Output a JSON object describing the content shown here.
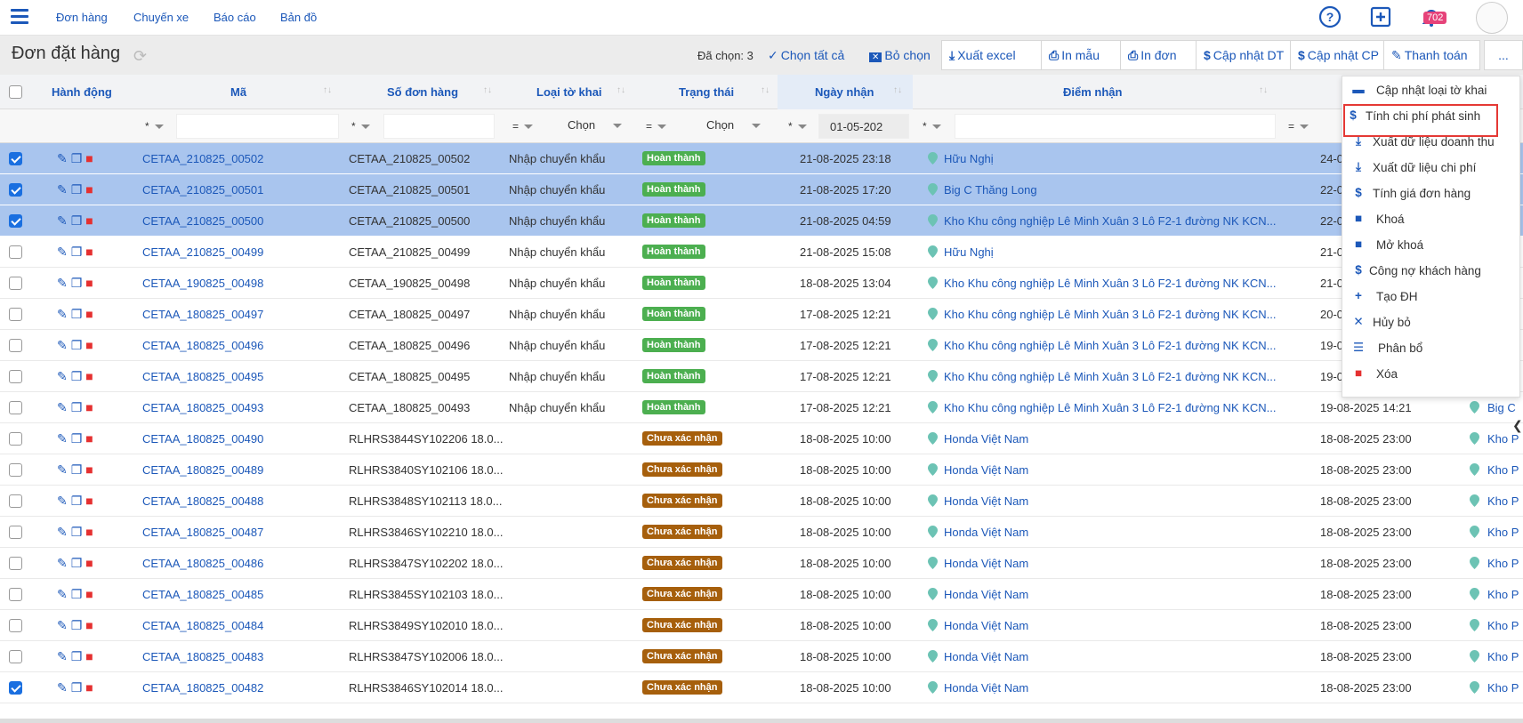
{
  "nav": {
    "links": [
      "Đơn hàng",
      "Chuyến xe",
      "Báo cáo",
      "Bản đồ"
    ],
    "notification_count": "702",
    "accent": "#1c58b9"
  },
  "toolbar": {
    "title": "Đơn đặt hàng",
    "selected": "Đã chọn: 3",
    "select_all": "Chọn tất cả",
    "deselect": "Bỏ chọn",
    "buttons": [
      "Xuất excel",
      "In mẫu",
      "In đơn",
      "Cập nhật DT",
      "Cập nhật CP",
      "Thanh toán",
      "..."
    ]
  },
  "table": {
    "headers": [
      "Hành động",
      "Mã",
      "Số đơn hàng",
      "Loại tờ khai",
      "Trạng thái",
      "Ngày nhận",
      "Điểm nhận"
    ],
    "filters": {
      "op_star": "*",
      "op_eq": "=",
      "select_placeholder": "Chọn",
      "date_value": "01-05-202"
    },
    "rows": [
      {
        "checked": true,
        "selected": true,
        "ma": "CETAA_210825_00502",
        "so": "CETAA_210825_00502",
        "loai": "Nhập chuyển khẩu",
        "status": "Hoàn thành",
        "status_kind": "done",
        "ngay": "21-08-2025 23:18",
        "diem": "Hữu Nghị",
        "ngay2": "24-0",
        "diem2": ""
      },
      {
        "checked": true,
        "selected": true,
        "ma": "CETAA_210825_00501",
        "so": "CETAA_210825_00501",
        "loai": "Nhập chuyển khẩu",
        "status": "Hoàn thành",
        "status_kind": "done",
        "ngay": "21-08-2025 17:20",
        "diem": "Big C Thăng Long",
        "ngay2": "22-0",
        "diem2": ""
      },
      {
        "checked": true,
        "selected": true,
        "ma": "CETAA_210825_00500",
        "so": "CETAA_210825_00500",
        "loai": "Nhập chuyển khẩu",
        "status": "Hoàn thành",
        "status_kind": "done",
        "ngay": "21-08-2025 04:59",
        "diem": "Kho Khu công nghiệp Lê Minh Xuân 3 Lô F2-1 đường NK KCN...",
        "ngay2": "22-0",
        "diem2": ""
      },
      {
        "checked": false,
        "selected": false,
        "ma": "CETAA_210825_00499",
        "so": "CETAA_210825_00499",
        "loai": "Nhập chuyển khẩu",
        "status": "Hoàn thành",
        "status_kind": "done",
        "ngay": "21-08-2025 15:08",
        "diem": "Hữu Nghị",
        "ngay2": "21-0",
        "diem2": ""
      },
      {
        "checked": false,
        "selected": false,
        "ma": "CETAA_190825_00498",
        "so": "CETAA_190825_00498",
        "loai": "Nhập chuyển khẩu",
        "status": "Hoàn thành",
        "status_kind": "done",
        "ngay": "18-08-2025 13:04",
        "diem": "Kho Khu công nghiệp Lê Minh Xuân 3 Lô F2-1 đường NK KCN...",
        "ngay2": "21-0",
        "diem2": ""
      },
      {
        "checked": false,
        "selected": false,
        "ma": "CETAA_180825_00497",
        "so": "CETAA_180825_00497",
        "loai": "Nhập chuyển khẩu",
        "status": "Hoàn thành",
        "status_kind": "done",
        "ngay": "17-08-2025 12:21",
        "diem": "Kho Khu công nghiệp Lê Minh Xuân 3 Lô F2-1 đường NK KCN...",
        "ngay2": "20-0",
        "diem2": ""
      },
      {
        "checked": false,
        "selected": false,
        "ma": "CETAA_180825_00496",
        "so": "CETAA_180825_00496",
        "loai": "Nhập chuyển khẩu",
        "status": "Hoàn thành",
        "status_kind": "done",
        "ngay": "17-08-2025 12:21",
        "diem": "Kho Khu công nghiệp Lê Minh Xuân 3 Lô F2-1 đường NK KCN...",
        "ngay2": "19-0",
        "diem2": ""
      },
      {
        "checked": false,
        "selected": false,
        "ma": "CETAA_180825_00495",
        "so": "CETAA_180825_00495",
        "loai": "Nhập chuyển khẩu",
        "status": "Hoàn thành",
        "status_kind": "done",
        "ngay": "17-08-2025 12:21",
        "diem": "Kho Khu công nghiệp Lê Minh Xuân 3 Lô F2-1 đường NK KCN...",
        "ngay2": "19-0",
        "diem2": ""
      },
      {
        "checked": false,
        "selected": false,
        "ma": "CETAA_180825_00493",
        "so": "CETAA_180825_00493",
        "loai": "Nhập chuyển khẩu",
        "status": "Hoàn thành",
        "status_kind": "done",
        "ngay": "17-08-2025 12:21",
        "diem": "Kho Khu công nghiệp Lê Minh Xuân 3 Lô F2-1 đường NK KCN...",
        "ngay2": "19-08-2025 14:21",
        "diem2": "Big C"
      },
      {
        "checked": false,
        "selected": false,
        "ma": "CETAA_180825_00490",
        "so": "RLHRS3844SY102206 18.0...",
        "loai": "",
        "status": "Chưa xác nhận",
        "status_kind": "wait",
        "ngay": "18-08-2025 10:00",
        "diem": "Honda Việt Nam",
        "ngay2": "18-08-2025 23:00",
        "diem2": "Kho P"
      },
      {
        "checked": false,
        "selected": false,
        "ma": "CETAA_180825_00489",
        "so": "RLHRS3840SY102106 18.0...",
        "loai": "",
        "status": "Chưa xác nhận",
        "status_kind": "wait",
        "ngay": "18-08-2025 10:00",
        "diem": "Honda Việt Nam",
        "ngay2": "18-08-2025 23:00",
        "diem2": "Kho P"
      },
      {
        "checked": false,
        "selected": false,
        "ma": "CETAA_180825_00488",
        "so": "RLHRS3848SY102113 18.0...",
        "loai": "",
        "status": "Chưa xác nhận",
        "status_kind": "wait",
        "ngay": "18-08-2025 10:00",
        "diem": "Honda Việt Nam",
        "ngay2": "18-08-2025 23:00",
        "diem2": "Kho P"
      },
      {
        "checked": false,
        "selected": false,
        "ma": "CETAA_180825_00487",
        "so": "RLHRS3846SY102210 18.0...",
        "loai": "",
        "status": "Chưa xác nhận",
        "status_kind": "wait",
        "ngay": "18-08-2025 10:00",
        "diem": "Honda Việt Nam",
        "ngay2": "18-08-2025 23:00",
        "diem2": "Kho P"
      },
      {
        "checked": false,
        "selected": false,
        "ma": "CETAA_180825_00486",
        "so": "RLHRS3847SY102202 18.0...",
        "loai": "",
        "status": "Chưa xác nhận",
        "status_kind": "wait",
        "ngay": "18-08-2025 10:00",
        "diem": "Honda Việt Nam",
        "ngay2": "18-08-2025 23:00",
        "diem2": "Kho P"
      },
      {
        "checked": false,
        "selected": false,
        "ma": "CETAA_180825_00485",
        "so": "RLHRS3845SY102103 18.0...",
        "loai": "",
        "status": "Chưa xác nhận",
        "status_kind": "wait",
        "ngay": "18-08-2025 10:00",
        "diem": "Honda Việt Nam",
        "ngay2": "18-08-2025 23:00",
        "diem2": "Kho P"
      },
      {
        "checked": false,
        "selected": false,
        "ma": "CETAA_180825_00484",
        "so": "RLHRS3849SY102010 18.0...",
        "loai": "",
        "status": "Chưa xác nhận",
        "status_kind": "wait",
        "ngay": "18-08-2025 10:00",
        "diem": "Honda Việt Nam",
        "ngay2": "18-08-2025 23:00",
        "diem2": "Kho P"
      },
      {
        "checked": false,
        "selected": false,
        "ma": "CETAA_180825_00483",
        "so": "RLHRS3847SY102006 18.0...",
        "loai": "",
        "status": "Chưa xác nhận",
        "status_kind": "wait",
        "ngay": "18-08-2025 10:00",
        "diem": "Honda Việt Nam",
        "ngay2": "18-08-2025 23:00",
        "diem2": "Kho P"
      },
      {
        "checked": true,
        "selected": false,
        "ma": "CETAA_180825_00482",
        "so": "RLHRS3846SY102014 18.0...",
        "loai": "",
        "status": "Chưa xác nhận",
        "status_kind": "wait",
        "ngay": "18-08-2025 10:00",
        "diem": "Honda Việt Nam",
        "ngay2": "18-08-2025 23:00",
        "diem2": "Kho P"
      }
    ]
  },
  "menu": {
    "items": [
      {
        "icon": "truck-icon",
        "label": "Cập nhật loại tờ khai"
      },
      {
        "icon": "dollar-icon",
        "label": "Tính chi phí phát sinh"
      },
      {
        "icon": "download-icon",
        "label": "Xuất dữ liệu doanh thu"
      },
      {
        "icon": "download-icon",
        "label": "Xuất dữ liệu chi phí"
      },
      {
        "icon": "dollar-icon",
        "label": "Tính giá đơn hàng"
      },
      {
        "icon": "lock-icon",
        "label": "Khoá"
      },
      {
        "icon": "unlock-icon",
        "label": "Mở khoá"
      },
      {
        "icon": "dollar-icon",
        "label": "Công nợ khách hàng"
      },
      {
        "icon": "plus-icon",
        "label": "Tạo ĐH"
      },
      {
        "icon": "close-icon",
        "label": "Hủy bỏ"
      },
      {
        "icon": "list-icon",
        "label": "Phân bổ"
      },
      {
        "icon": "trash-icon",
        "label": "Xóa"
      }
    ],
    "highlighted_item": "Tính chi phí phát sinh",
    "highlight_color": "#e53935"
  },
  "colors": {
    "status_done": "#4caf50",
    "status_wait": "#a65f0c",
    "selected_row": "#a9c5ee",
    "pin": "#6cc3b4"
  }
}
